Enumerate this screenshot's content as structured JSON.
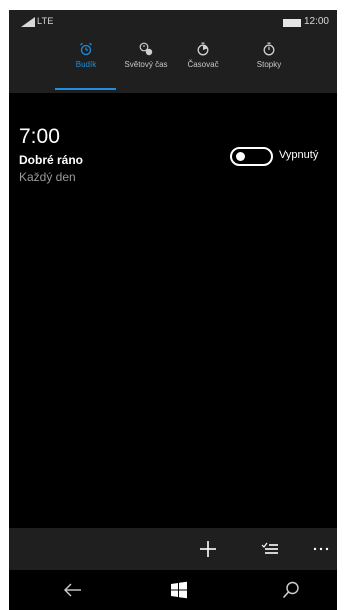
{
  "status_bar": {
    "network": "LTE",
    "time": "12:00"
  },
  "tabs": [
    {
      "label": "Budík",
      "icon": "alarm-clock-icon",
      "active": true
    },
    {
      "label": "Světový čas",
      "icon": "world-clock-icon",
      "active": false
    },
    {
      "label": "Časovač",
      "icon": "timer-icon",
      "active": false
    },
    {
      "label": "Stopky",
      "icon": "stopwatch-icon",
      "active": false
    }
  ],
  "alarm": {
    "time": "7:00",
    "name": "Dobré ráno",
    "repeat": "Každý den",
    "enabled": false,
    "toggle_label": "Vypnutý"
  },
  "app_bar": {
    "buttons": [
      "add-icon",
      "select-icon",
      "more-icon"
    ]
  },
  "nav_bar": {
    "buttons": [
      "back-icon",
      "windows-icon",
      "search-icon"
    ]
  },
  "colors": {
    "accent": "#1e8fe0",
    "background": "#000000",
    "header": "#1f1f1f",
    "secondary_text": "#9a9a9a"
  }
}
